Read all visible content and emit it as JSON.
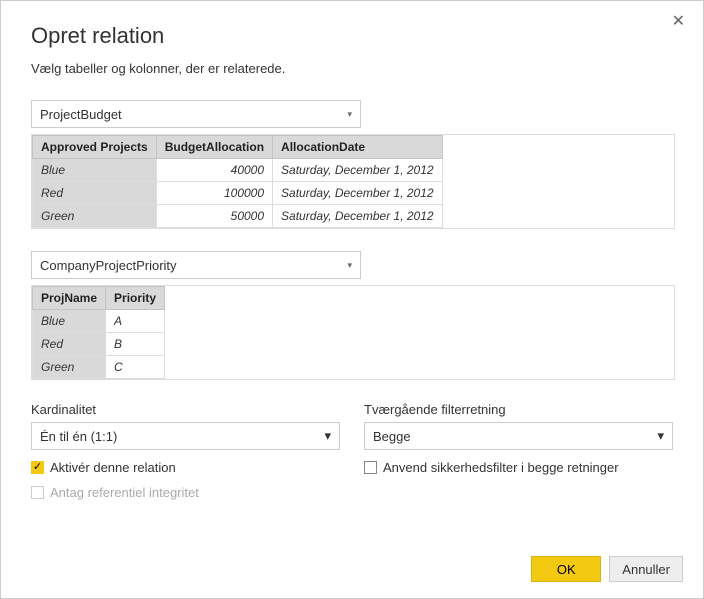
{
  "dialog": {
    "title": "Opret relation",
    "subtitle": "Vælg tabeller og kolonner, der er relaterede."
  },
  "table1": {
    "selected": "ProjectBudget",
    "headers": [
      "Approved Projects",
      "BudgetAllocation",
      "AllocationDate"
    ],
    "rows": [
      {
        "c0": "Blue",
        "c1": "40000",
        "c2": "Saturday, December 1, 2012"
      },
      {
        "c0": "Red",
        "c1": "100000",
        "c2": "Saturday, December 1, 2012"
      },
      {
        "c0": "Green",
        "c1": "50000",
        "c2": "Saturday, December 1, 2012"
      }
    ]
  },
  "table2": {
    "selected": "CompanyProjectPriority",
    "headers": [
      "ProjName",
      "Priority"
    ],
    "rows": [
      {
        "c0": "Blue",
        "c1": "A"
      },
      {
        "c0": "Red",
        "c1": "B"
      },
      {
        "c0": "Green",
        "c1": "C"
      }
    ]
  },
  "cardinality": {
    "label": "Kardinalitet",
    "value": "Én til én (1:1)"
  },
  "crossfilter": {
    "label": "Tværgående filterretning",
    "value": "Begge"
  },
  "checkboxes": {
    "active_label": "Aktivér denne relation",
    "security_label": "Anvend sikkerhedsfilter i begge retninger",
    "integrity_label": "Antag referentiel integritet",
    "checkmark": "✓"
  },
  "buttons": {
    "ok": "OK",
    "cancel": "Annuller"
  }
}
